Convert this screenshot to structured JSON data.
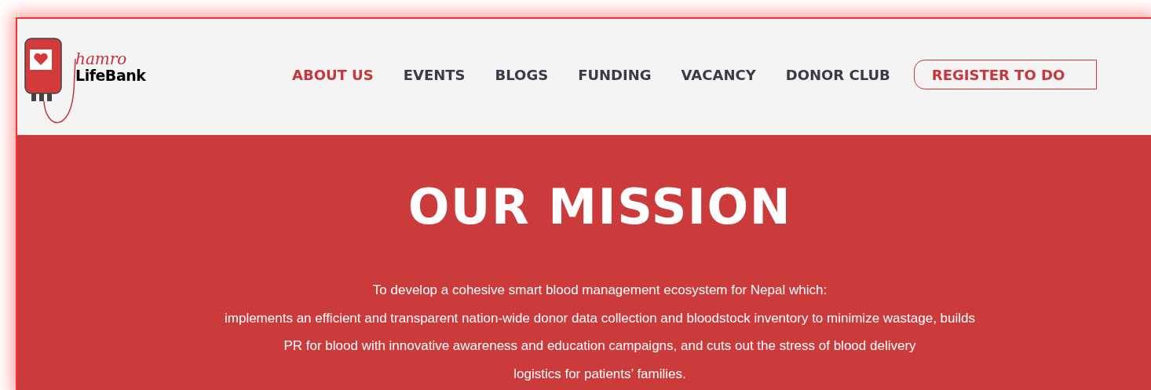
{
  "logo": {
    "script": "hamro",
    "name": "LifeBank"
  },
  "nav": [
    {
      "label": "ABOUT US",
      "selected": true
    },
    {
      "label": "EVENTS",
      "selected": false
    },
    {
      "label": "BLOGS",
      "selected": false
    },
    {
      "label": "FUNDING",
      "selected": false
    },
    {
      "label": "VACANCY",
      "selected": false
    },
    {
      "label": "DONOR CLUB",
      "selected": false
    }
  ],
  "cta": {
    "label": "REGISTER TO DO"
  },
  "mission": {
    "title": "OUR MISSION",
    "lines": [
      "To develop a cohesive smart blood management ecosystem for Nepal which:",
      "implements an efficient and transparent nation-wide donor data collection and bloodstock inventory to minimize wastage, builds",
      "PR for blood with innovative awareness and education campaigns, and cuts out the stress of blood delivery",
      "logistics for patients’ families."
    ]
  }
}
